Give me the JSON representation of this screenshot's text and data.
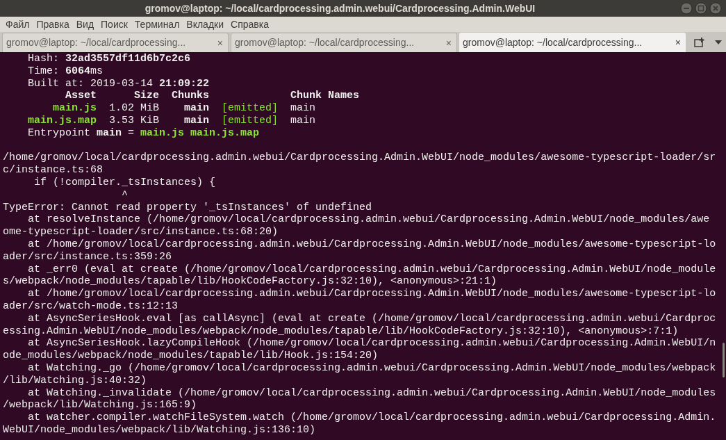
{
  "window": {
    "title": "gromov@laptop: ~/local/cardprocessing.admin.webui/Cardprocessing.Admin.WebUI"
  },
  "menu": [
    "Файл",
    "Правка",
    "Вид",
    "Поиск",
    "Терминал",
    "Вкладки",
    "Справка"
  ],
  "tabs": [
    {
      "label": "gromov@laptop: ~/local/cardprocessing...",
      "close": "×",
      "selected": false
    },
    {
      "label": "gromov@laptop: ~/local/cardprocessing...",
      "close": "×",
      "selected": false
    },
    {
      "label": "gromov@laptop: ~/local/cardprocessing...",
      "close": "×",
      "selected": true
    }
  ],
  "terminal": {
    "lines": [
      {
        "kind": "text",
        "segments": [
          {
            "text": "    Hash: ",
            "kind": "plain"
          },
          {
            "text": "32ad3557df11d6b7c2c6",
            "kind": "bold"
          }
        ]
      },
      {
        "kind": "text",
        "segments": [
          {
            "text": "    Time: ",
            "kind": "plain"
          },
          {
            "text": "6064",
            "kind": "bold"
          },
          {
            "text": "ms",
            "kind": "plain"
          }
        ]
      },
      {
        "kind": "text",
        "segments": [
          {
            "text": "    Built at: 2019-03-14 ",
            "kind": "plain"
          },
          {
            "text": "21:09:22",
            "kind": "bold"
          }
        ]
      },
      {
        "kind": "text",
        "segments": [
          {
            "text": "          Asset      Size  Chunks             Chunk Names",
            "kind": "bold"
          }
        ]
      },
      {
        "kind": "text",
        "segments": [
          {
            "text": "        main.js",
            "kind": "green_bold"
          },
          {
            "text": "  1.02 MiB    ",
            "kind": "plain"
          },
          {
            "text": "main",
            "kind": "bold"
          },
          {
            "text": "  [emitted]",
            "kind": "green"
          },
          {
            "text": "  main",
            "kind": "plain"
          }
        ]
      },
      {
        "kind": "text",
        "segments": [
          {
            "text": "    main.js.map",
            "kind": "green_bold"
          },
          {
            "text": "  3.53 KiB    ",
            "kind": "plain"
          },
          {
            "text": "main",
            "kind": "bold"
          },
          {
            "text": "  [emitted]",
            "kind": "green"
          },
          {
            "text": "  main",
            "kind": "plain"
          }
        ]
      },
      {
        "kind": "text",
        "segments": [
          {
            "text": "    Entrypoint ",
            "kind": "plain"
          },
          {
            "text": "main",
            "kind": "bold"
          },
          {
            "text": " = ",
            "kind": "plain"
          },
          {
            "text": "main.js main.js.map",
            "kind": "green_bold"
          }
        ]
      },
      {
        "kind": "blank"
      },
      {
        "kind": "text",
        "segments": [
          {
            "text": "/home/gromov/local/cardprocessing.admin.webui/Cardprocessing.Admin.WebUI/node_modules/awesome-typescript-loader/sr",
            "kind": "plain"
          }
        ]
      },
      {
        "kind": "text",
        "segments": [
          {
            "text": "c/instance.ts:68",
            "kind": "plain"
          }
        ]
      },
      {
        "kind": "text",
        "segments": [
          {
            "text": "     if (!compiler._tsInstances) {",
            "kind": "plain"
          }
        ]
      },
      {
        "kind": "text",
        "segments": [
          {
            "text": "                   ^",
            "kind": "plain"
          }
        ]
      },
      {
        "kind": "text",
        "segments": [
          {
            "text": "TypeError: Cannot read property '_tsInstances' of undefined",
            "kind": "plain"
          }
        ]
      },
      {
        "kind": "text",
        "segments": [
          {
            "text": "    at resolveInstance (/home/gromov/local/cardprocessing.admin.webui/Cardprocessing.Admin.WebUI/node_modules/awe",
            "kind": "plain"
          }
        ]
      },
      {
        "kind": "text",
        "segments": [
          {
            "text": "ome-typescript-loader/src/instance.ts:68:20)",
            "kind": "plain"
          }
        ]
      },
      {
        "kind": "text",
        "segments": [
          {
            "text": "    at /home/gromov/local/cardprocessing.admin.webui/Cardprocessing.Admin.WebUI/node_modules/awesome-typescript-lo",
            "kind": "plain"
          }
        ]
      },
      {
        "kind": "text",
        "segments": [
          {
            "text": "ader/src/instance.ts:359:26",
            "kind": "plain"
          }
        ]
      },
      {
        "kind": "text",
        "segments": [
          {
            "text": "    at _err0 (eval at create (/home/gromov/local/cardprocessing.admin.webui/Cardprocessing.Admin.WebUI/node_module",
            "kind": "plain"
          }
        ]
      },
      {
        "kind": "text",
        "segments": [
          {
            "text": "s/webpack/node_modules/tapable/lib/HookCodeFactory.js:32:10), <anonymous>:21:1)",
            "kind": "plain"
          }
        ]
      },
      {
        "kind": "text",
        "segments": [
          {
            "text": "    at /home/gromov/local/cardprocessing.admin.webui/Cardprocessing.Admin.WebUI/node_modules/awesome-typescript-lo",
            "kind": "plain"
          }
        ]
      },
      {
        "kind": "text",
        "segments": [
          {
            "text": "ader/src/watch-mode.ts:12:13",
            "kind": "plain"
          }
        ]
      },
      {
        "kind": "text",
        "segments": [
          {
            "text": "    at AsyncSeriesHook.eval [as callAsync] (eval at create (/home/gromov/local/cardprocessing.admin.webui/Cardproc",
            "kind": "plain"
          }
        ]
      },
      {
        "kind": "text",
        "segments": [
          {
            "text": "essing.Admin.WebUI/node_modules/webpack/node_modules/tapable/lib/HookCodeFactory.js:32:10), <anonymous>:7:1)",
            "kind": "plain"
          }
        ]
      },
      {
        "kind": "text",
        "segments": [
          {
            "text": "    at AsyncSeriesHook.lazyCompileHook (/home/gromov/local/cardprocessing.admin.webui/Cardprocessing.Admin.WebUI/n",
            "kind": "plain"
          }
        ]
      },
      {
        "kind": "text",
        "segments": [
          {
            "text": "ode_modules/webpack/node_modules/tapable/lib/Hook.js:154:20)",
            "kind": "plain"
          }
        ]
      },
      {
        "kind": "text",
        "segments": [
          {
            "text": "    at Watching._go (/home/gromov/local/cardprocessing.admin.webui/Cardprocessing.Admin.WebUI/node_modules/webpack",
            "kind": "plain"
          }
        ]
      },
      {
        "kind": "text",
        "segments": [
          {
            "text": "/lib/Watching.js:40:32)",
            "kind": "plain"
          }
        ]
      },
      {
        "kind": "text",
        "segments": [
          {
            "text": "    at Watching._invalidate (/home/gromov/local/cardprocessing.admin.webui/Cardprocessing.Admin.WebUI/node_modules",
            "kind": "plain"
          }
        ]
      },
      {
        "kind": "text",
        "segments": [
          {
            "text": "/webpack/lib/Watching.js:165:9)",
            "kind": "plain"
          }
        ]
      },
      {
        "kind": "text",
        "segments": [
          {
            "text": "    at watcher.compiler.watchFileSystem.watch (/home/gromov/local/cardprocessing.admin.webui/Cardprocessing.Admin.",
            "kind": "plain"
          }
        ]
      },
      {
        "kind": "text",
        "segments": [
          {
            "text": "WebUI/node_modules/webpack/lib/Watching.js:136:10)",
            "kind": "plain"
          }
        ]
      }
    ]
  }
}
